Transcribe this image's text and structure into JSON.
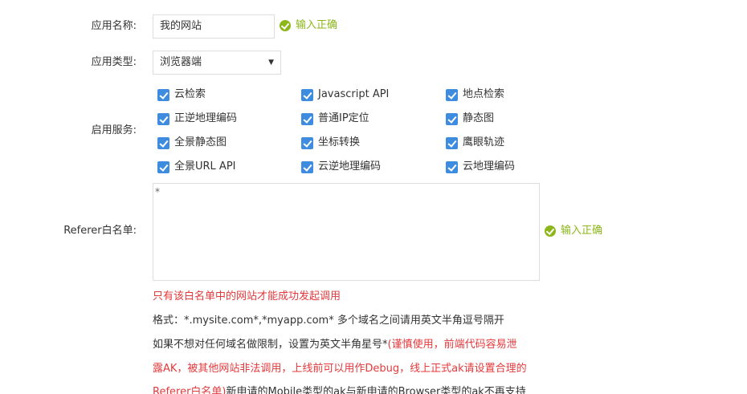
{
  "form": {
    "app_name": {
      "label": "应用名称:",
      "value": "我的网站",
      "validation": "输入正确"
    },
    "app_type": {
      "label": "应用类型:",
      "value": "浏览器端"
    },
    "services": {
      "label": "启用服务:",
      "items": [
        {
          "label": "云检索",
          "checked": true
        },
        {
          "label": "Javascript API",
          "checked": true
        },
        {
          "label": "地点检索",
          "checked": true
        },
        {
          "label": "正逆地理编码",
          "checked": true
        },
        {
          "label": "普通IP定位",
          "checked": true
        },
        {
          "label": "静态图",
          "checked": true
        },
        {
          "label": "全景静态图",
          "checked": true
        },
        {
          "label": "坐标转换",
          "checked": true
        },
        {
          "label": "鹰眼轨迹",
          "checked": true
        },
        {
          "label": "全景URL API",
          "checked": true
        },
        {
          "label": "云逆地理编码",
          "checked": true
        },
        {
          "label": "云地理编码",
          "checked": true
        }
      ]
    },
    "referer": {
      "label": "Referer白名单:",
      "value": "*",
      "validation": "输入正确",
      "warning": "只有该白名单中的网站才能成功发起调用",
      "format": "格式：*.mysite.com*,*myapp.com* 多个域名之间请用英文半角逗号隔开",
      "hint_line1_normal": "如果不想对任何域名做限制，设置为英文半角星号*",
      "hint_line1_red": "(谨慎使用，前端代码容易泄",
      "hint_line2_red": "露AK，被其他网站非法调用，上线前可以用作Debug，线上正式ak请设置合理的",
      "hint_line3_red": "Referer白名单)",
      "hint_line3_normal": "新申请的Mobile类型的ak与新申请的Browser类型的ak不再支持"
    }
  },
  "colors": {
    "accent_checkbox": "#3d8ce0",
    "valid_green": "#8cb61a",
    "warning_red": "#e4393c"
  }
}
